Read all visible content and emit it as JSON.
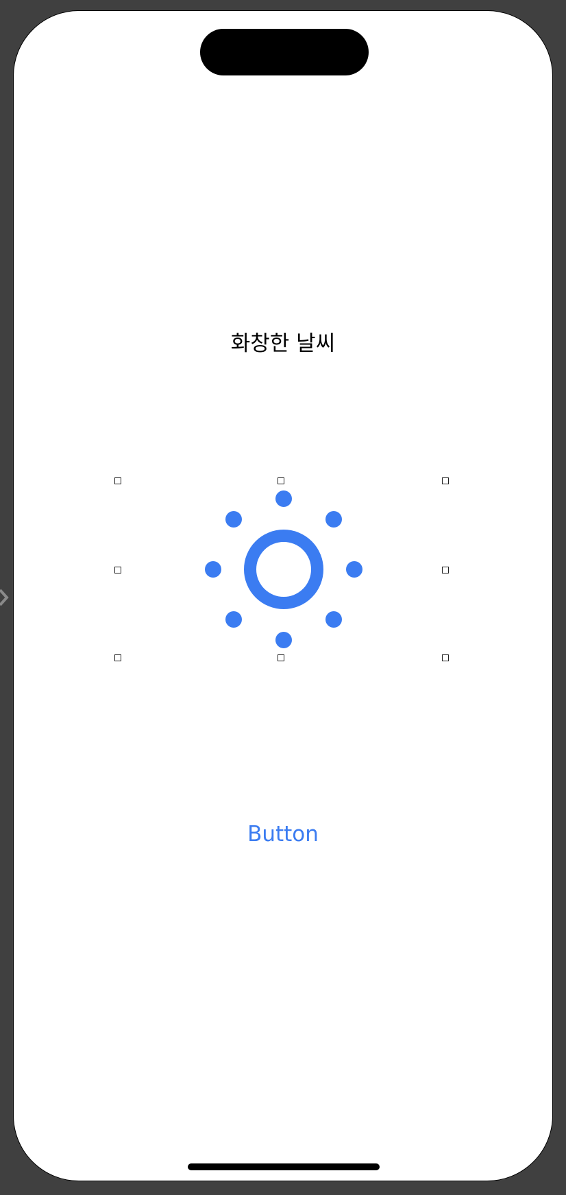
{
  "screen": {
    "title": "화창한 날씨",
    "weather_icon": "sun-icon",
    "button_label": "Button"
  },
  "colors": {
    "accent": "#3b7cf1",
    "background": "#404040",
    "screen": "#ffffff"
  }
}
